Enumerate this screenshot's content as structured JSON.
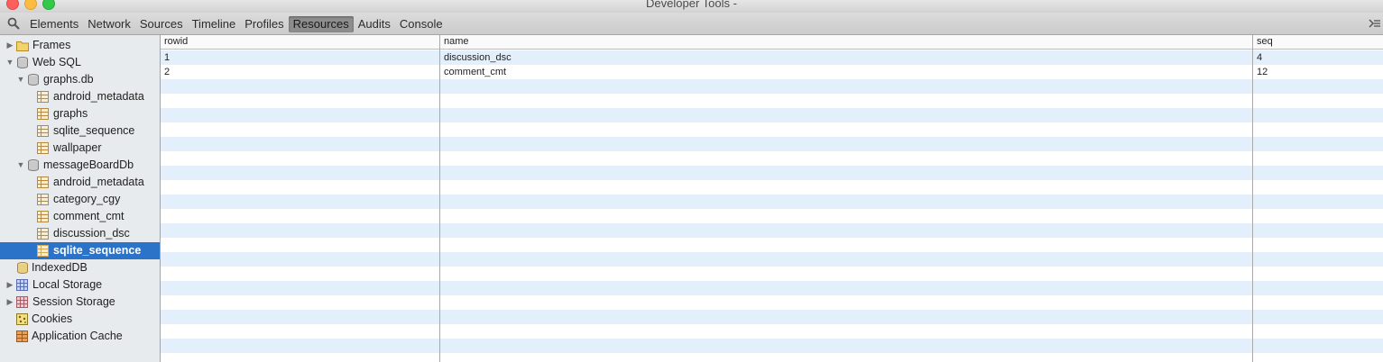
{
  "window": {
    "title": "Developer Tools -"
  },
  "toolbar": {
    "tabs": [
      {
        "label": "Elements"
      },
      {
        "label": "Network"
      },
      {
        "label": "Sources"
      },
      {
        "label": "Timeline"
      },
      {
        "label": "Profiles"
      },
      {
        "label": "Resources",
        "selected": true
      },
      {
        "label": "Audits"
      },
      {
        "label": "Console"
      }
    ]
  },
  "sidebar": {
    "items": [
      {
        "label": "Frames",
        "icon": "folder-icon",
        "expanded": false
      },
      {
        "label": "Web SQL",
        "icon": "database-icon",
        "expanded": true
      },
      {
        "label": "graphs.db",
        "icon": "database-icon",
        "expanded": true
      },
      {
        "label": "android_metadata",
        "icon": "table-icon"
      },
      {
        "label": "graphs",
        "icon": "table-icon"
      },
      {
        "label": "sqlite_sequence",
        "icon": "table-icon"
      },
      {
        "label": "wallpaper",
        "icon": "table-icon"
      },
      {
        "label": "messageBoardDb",
        "icon": "database-icon",
        "expanded": true
      },
      {
        "label": "android_metadata",
        "icon": "table-icon"
      },
      {
        "label": "category_cgy",
        "icon": "table-icon"
      },
      {
        "label": "comment_cmt",
        "icon": "table-icon"
      },
      {
        "label": "discussion_dsc",
        "icon": "table-icon"
      },
      {
        "label": "sqlite_sequence",
        "icon": "table-icon",
        "selected": true
      },
      {
        "label": "IndexedDB",
        "icon": "database-icon"
      },
      {
        "label": "Local Storage",
        "icon": "storage-grid-icon",
        "expanded": false
      },
      {
        "label": "Session Storage",
        "icon": "storage-grid-icon",
        "expanded": false
      },
      {
        "label": "Cookies",
        "icon": "cookie-icon"
      },
      {
        "label": "Application Cache",
        "icon": "app-cache-icon"
      }
    ]
  },
  "table": {
    "columns": [
      "rowid",
      "name",
      "seq"
    ],
    "rows": [
      [
        "1",
        "discussion_dsc",
        "4"
      ],
      [
        "2",
        "comment_cmt",
        "12"
      ]
    ]
  },
  "colors": {
    "selection": "#2a73c8",
    "stripe": "#e3f0fb",
    "sidebar_bg": "#e8ebee"
  }
}
